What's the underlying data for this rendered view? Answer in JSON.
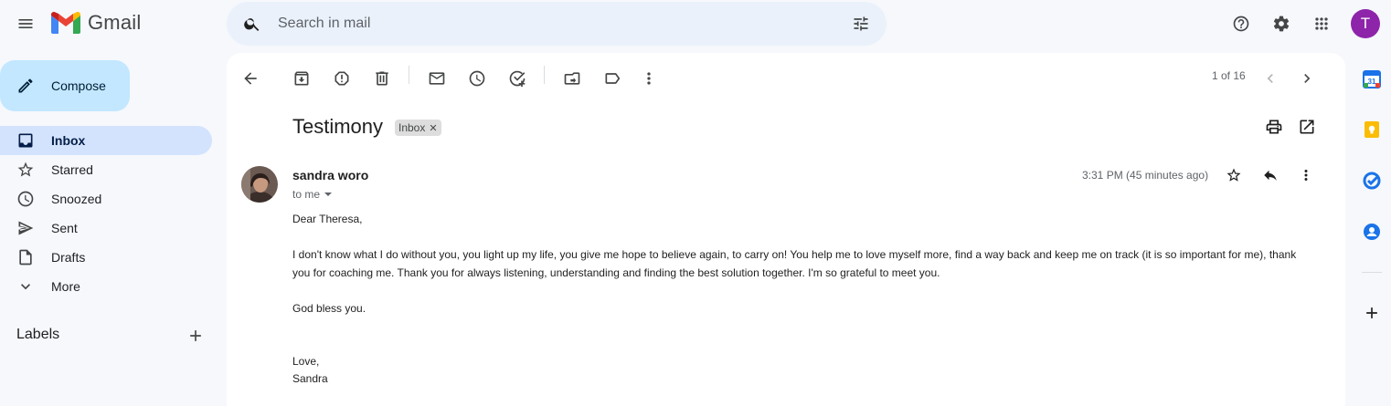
{
  "app": {
    "name": "Gmail",
    "avatar_initial": "T"
  },
  "search": {
    "placeholder": "Search in mail"
  },
  "compose": {
    "label": "Compose"
  },
  "nav": {
    "items": [
      {
        "label": "Inbox",
        "active": true,
        "icon": "inbox-icon"
      },
      {
        "label": "Starred",
        "icon": "star-icon"
      },
      {
        "label": "Snoozed",
        "icon": "clock-icon"
      },
      {
        "label": "Sent",
        "icon": "send-icon"
      },
      {
        "label": "Drafts",
        "icon": "draft-icon"
      },
      {
        "label": "More",
        "icon": "chevron-down-icon"
      }
    ],
    "labels_title": "Labels"
  },
  "toolbar": {
    "pager": "1 of 16"
  },
  "message": {
    "subject": "Testimony",
    "label_chip": "Inbox",
    "sender": "sandra woro",
    "to": "to me",
    "time": "3:31 PM (45 minutes ago)",
    "body": {
      "greeting": "Dear Theresa,",
      "paragraph": "I don't know what I do without you, you light up my life, you give me hope to believe again, to carry on! You help me to love myself more, find a way back and keep me on track (it is so important for me), thank you for coaching me. Thank you for always listening, understanding and finding the best solution together. I'm so grateful to meet  you.",
      "blessing": "God bless you.",
      "closing": "Love,",
      "signature": "Sandra"
    }
  },
  "colors": {
    "background": "#f6f8fc",
    "compose": "#c2e7ff",
    "active_nav": "#d3e3fd",
    "avatar": "#8e24aa"
  }
}
